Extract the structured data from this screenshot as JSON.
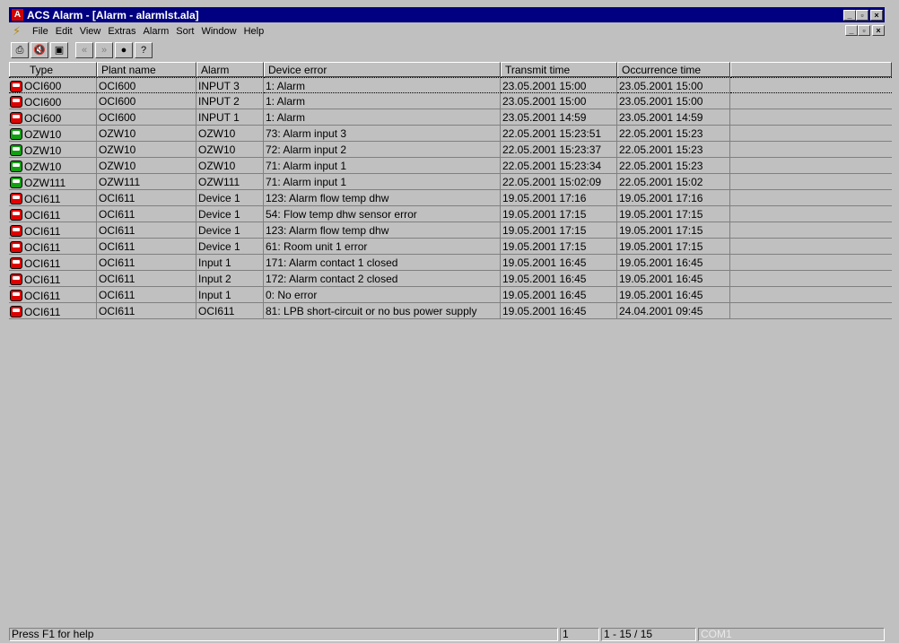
{
  "window": {
    "title": "ACS Alarm - [Alarm - alarmlst.ala]",
    "app_icon_glyph": "A",
    "buttons": {
      "minimize": "_",
      "restore": "▫",
      "close": "×"
    }
  },
  "menu": {
    "items": [
      {
        "label": "File"
      },
      {
        "label": "Edit"
      },
      {
        "label": "View"
      },
      {
        "label": "Extras"
      },
      {
        "label": "Alarm"
      },
      {
        "label": "Sort"
      },
      {
        "label": "Window"
      },
      {
        "label": "Help"
      }
    ]
  },
  "toolbar": {
    "buttons": [
      {
        "icon": "printer-icon",
        "glyph": "⎙"
      },
      {
        "icon": "speaker-mute-icon",
        "glyph": "🔇"
      },
      {
        "icon": "properties-icon",
        "glyph": "▣"
      },
      {
        "icon": "previous-icon",
        "glyph": "«"
      },
      {
        "icon": "next-icon",
        "glyph": "»"
      },
      {
        "icon": "record-icon",
        "glyph": "●"
      },
      {
        "icon": "help-icon",
        "glyph": "?"
      }
    ]
  },
  "table": {
    "columns": [
      "Type",
      "Plant name",
      "Alarm",
      "Device error",
      "Transmit time",
      "Occurrence time"
    ],
    "rows": [
      {
        "status": "red",
        "type": "OCI600",
        "plant": "OCI600",
        "alarm": "INPUT 3",
        "error": "1: Alarm",
        "transmit": "23.05.2001 15:00",
        "occurrence": "23.05.2001 15:00"
      },
      {
        "status": "red",
        "type": "OCI600",
        "plant": "OCI600",
        "alarm": "INPUT 2",
        "error": "1: Alarm",
        "transmit": "23.05.2001 15:00",
        "occurrence": "23.05.2001 15:00"
      },
      {
        "status": "red",
        "type": "OCI600",
        "plant": "OCI600",
        "alarm": "INPUT 1",
        "error": "1: Alarm",
        "transmit": "23.05.2001 14:59",
        "occurrence": "23.05.2001 14:59"
      },
      {
        "status": "green",
        "type": "OZW10",
        "plant": "OZW10",
        "alarm": "OZW10",
        "error": "73: Alarm input 3",
        "transmit": "22.05.2001 15:23:51",
        "occurrence": "22.05.2001 15:23"
      },
      {
        "status": "green",
        "type": "OZW10",
        "plant": "OZW10",
        "alarm": "OZW10",
        "error": "72: Alarm input 2",
        "transmit": "22.05.2001 15:23:37",
        "occurrence": "22.05.2001 15:23"
      },
      {
        "status": "green",
        "type": "OZW10",
        "plant": "OZW10",
        "alarm": "OZW10",
        "error": "71: Alarm input 1",
        "transmit": "22.05.2001 15:23:34",
        "occurrence": "22.05.2001 15:23"
      },
      {
        "status": "green",
        "type": "OZW111",
        "plant": "OZW111",
        "alarm": "OZW111",
        "error": "71: Alarm input 1",
        "transmit": "22.05.2001 15:02:09",
        "occurrence": "22.05.2001 15:02"
      },
      {
        "status": "red",
        "type": "OCI611",
        "plant": "OCI611",
        "alarm": "Device 1",
        "error": "123: Alarm flow temp dhw",
        "transmit": "19.05.2001 17:16",
        "occurrence": "19.05.2001 17:16"
      },
      {
        "status": "red",
        "type": "OCI611",
        "plant": "OCI611",
        "alarm": "Device 1",
        "error": "54: Flow temp dhw sensor error",
        "transmit": "19.05.2001 17:15",
        "occurrence": "19.05.2001 17:15"
      },
      {
        "status": "red",
        "type": "OCI611",
        "plant": "OCI611",
        "alarm": "Device 1",
        "error": "123: Alarm flow temp dhw",
        "transmit": "19.05.2001 17:15",
        "occurrence": "19.05.2001 17:15"
      },
      {
        "status": "red",
        "type": "OCI611",
        "plant": "OCI611",
        "alarm": "Device 1",
        "error": "61: Room unit 1 error",
        "transmit": "19.05.2001 17:15",
        "occurrence": "19.05.2001 17:15"
      },
      {
        "status": "red",
        "type": "OCI611",
        "plant": "OCI611",
        "alarm": "Input 1",
        "error": "171: Alarm contact 1 closed",
        "transmit": "19.05.2001 16:45",
        "occurrence": "19.05.2001 16:45"
      },
      {
        "status": "red",
        "type": "OCI611",
        "plant": "OCI611",
        "alarm": "Input 2",
        "error": "172: Alarm contact 2 closed",
        "transmit": "19.05.2001 16:45",
        "occurrence": "19.05.2001 16:45"
      },
      {
        "status": "red",
        "type": "OCI611",
        "plant": "OCI611",
        "alarm": "Input 1",
        "error": "0: No error",
        "transmit": "19.05.2001 16:45",
        "occurrence": "19.05.2001 16:45"
      },
      {
        "status": "red",
        "type": "OCI611",
        "plant": "OCI611",
        "alarm": "OCI611",
        "error": "81: LPB short-circuit or no bus power supply",
        "transmit": "19.05.2001 16:45",
        "occurrence": "24.04.2001 09:45"
      }
    ]
  },
  "status": {
    "help": "Press F1 for help",
    "field1": "1",
    "range": "1 - 15 / 15",
    "port": "COM1"
  },
  "colors": {
    "title_bar": "#000080",
    "alarm_red": "#e00000",
    "alarm_green": "#10a010"
  }
}
